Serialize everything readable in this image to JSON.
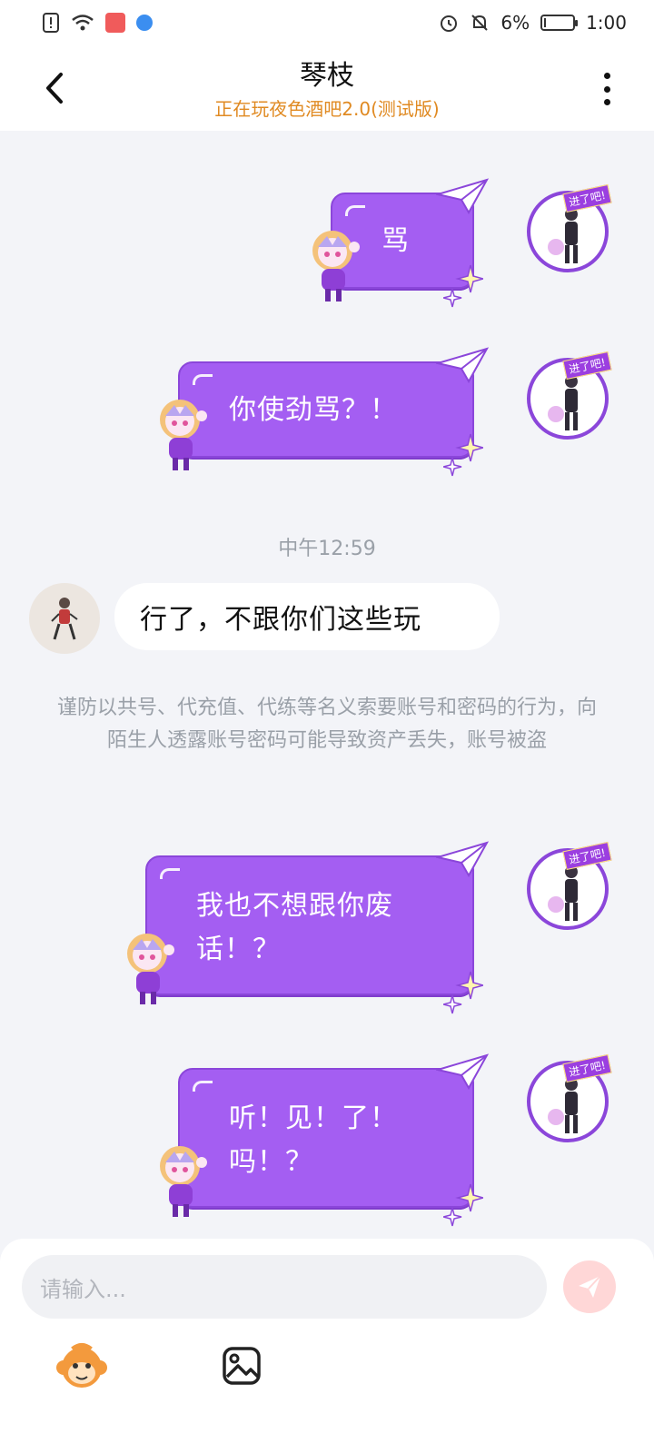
{
  "status_bar": {
    "battery_percent": "6%",
    "time": "1:00",
    "battery_level": 0.06,
    "icons": [
      "alert-icon",
      "wifi-icon",
      "app-notification-icon",
      "browser-icon",
      "alarm-icon",
      "mute-icon",
      "battery-icon"
    ]
  },
  "header": {
    "title": "琴枝",
    "subtitle": "正在玩夜色酒吧2.0(测试版)",
    "subtitle_color": "#e08a22"
  },
  "messages": {
    "m1": "骂",
    "m2": "你使劲骂？！",
    "time_divider": "中午12:59",
    "m3": "行了，不跟你们这些玩",
    "notice": "谨防以共号、代充值、代练等名义索要账号和密码的行为，向陌生人透露账号密码可能导致资产丢失，账号被盗",
    "m4": "我也不想跟你废\n话！？",
    "m5": "听！见！了！\n吗！？"
  },
  "avatar_badge": "进了吧!",
  "input": {
    "placeholder": "请输入..."
  },
  "colors": {
    "bubble_purple": "#a45ef2",
    "background": "#f3f4f8",
    "send_button": "#ffd7d7"
  }
}
